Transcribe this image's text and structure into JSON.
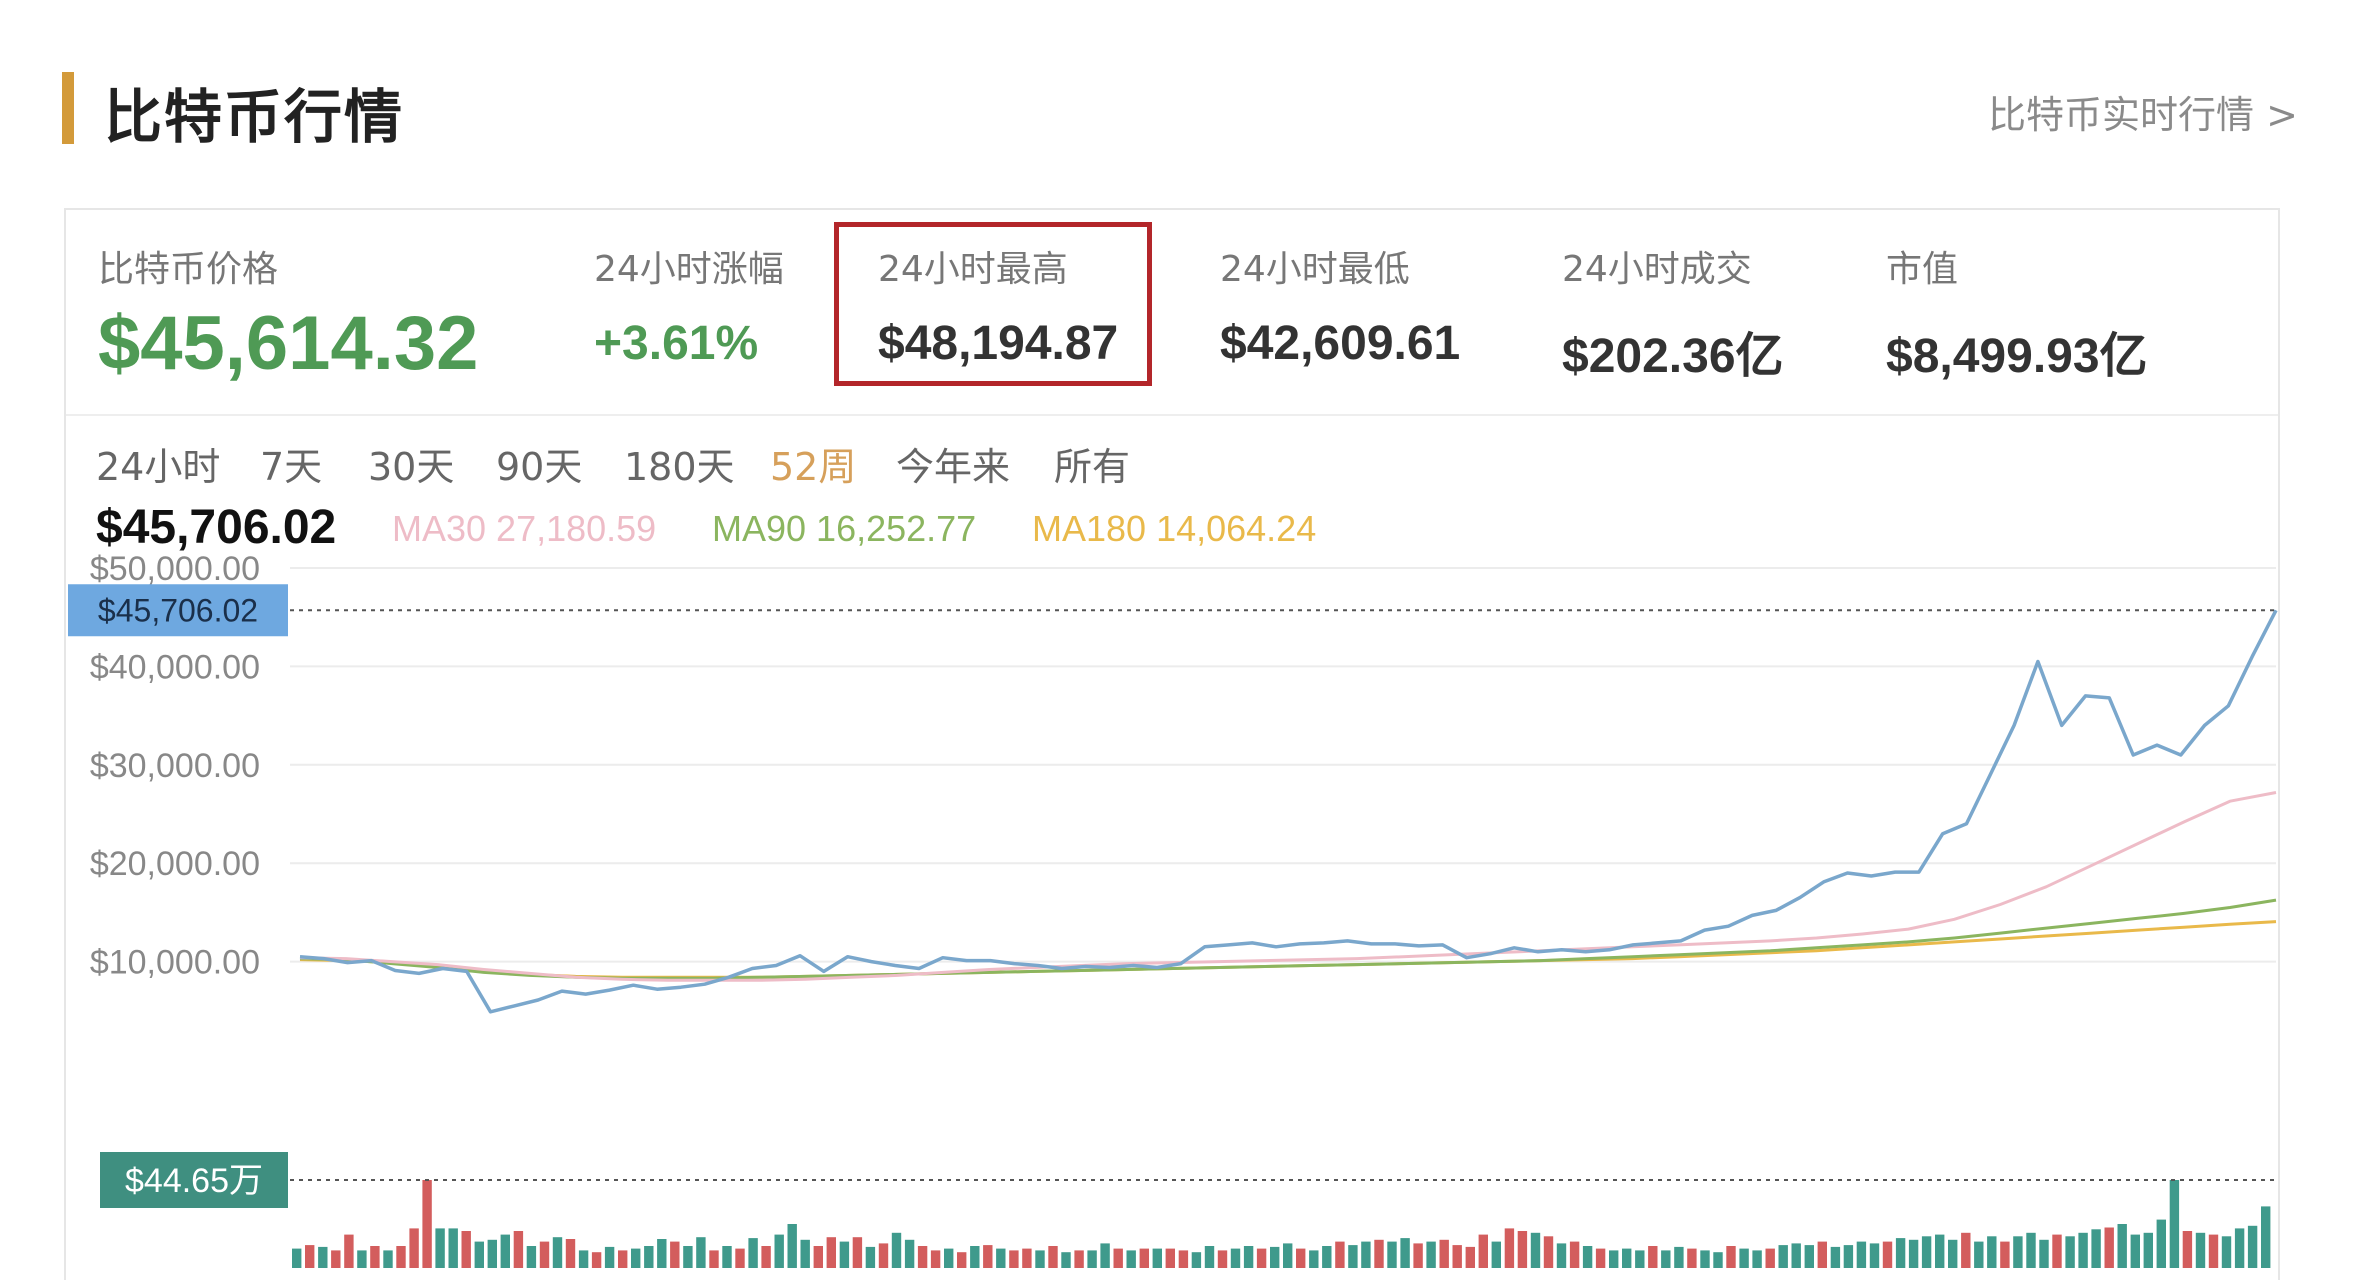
{
  "header": {
    "title": "比特币行情",
    "realtime_link": "比特币实时行情 >"
  },
  "stats": [
    {
      "label": "比特币价格",
      "value": "$45,614.32"
    },
    {
      "label": "24小时涨幅",
      "value": "+3.61%"
    },
    {
      "label": "24小时最高",
      "value": "$48,194.87"
    },
    {
      "label": "24小时最低",
      "value": "$42,609.61"
    },
    {
      "label": "24小时成交",
      "value": "$202.36亿"
    },
    {
      "label": "市值",
      "value": "$8,499.93亿"
    }
  ],
  "ranges": [
    "24小时",
    "7天",
    "30天",
    "90天",
    "180天",
    "52周",
    "今年来",
    "所有"
  ],
  "active_range": "52周",
  "current_price": "$45,706.02",
  "ma": [
    {
      "label": "MA30 27,180.59",
      "color": "#eebcc7"
    },
    {
      "label": "MA90 16,252.77",
      "color": "#8bb55f"
    },
    {
      "label": "MA180 14,064.24",
      "color": "#e9b94a"
    }
  ],
  "colors": {
    "price_up": "#4f9a55",
    "price_line": "#7aa7cc",
    "vol_up": "#3f9a8c",
    "vol_down": "#d35d5d",
    "price_tag": "#6ea8e0",
    "vol_tag": "#3f8f80"
  },
  "chart_data": {
    "type": "line",
    "ylim": [
      0,
      50000
    ],
    "y_ticks": [
      "$50,000.00",
      "$40,000.00",
      "$30,000.00",
      "$20,000.00",
      "$10,000.00"
    ],
    "y_tick_values": [
      50000,
      40000,
      30000,
      20000,
      10000
    ],
    "price_marker": {
      "label": "$45,706.02",
      "value": 45706.02
    },
    "volume_marker": {
      "label": "$44.65万"
    },
    "series": [
      {
        "name": "",
        "values": [
          10500,
          10300,
          9900,
          10100,
          9100,
          8800,
          9300,
          9000,
          4900,
          5500,
          6100,
          7000,
          6700,
          7100,
          7600,
          7200,
          7400,
          7700,
          8400,
          9300,
          9600,
          10600,
          9000,
          10500,
          10000,
          9600,
          9300,
          10400,
          10100,
          10100,
          9800,
          9600,
          9300,
          9500,
          9400,
          9600,
          9400,
          9800,
          11500,
          11700,
          11900,
          11500,
          11800,
          11900,
          12100,
          11800,
          11800,
          11600,
          11700,
          10400,
          10800,
          11400,
          11000,
          11200,
          11000,
          11200,
          11700,
          11900,
          12100,
          13200,
          13600,
          14700,
          15200,
          16500,
          18100,
          19000,
          18700,
          19100,
          19100,
          23000,
          24000,
          29000,
          34000,
          40500,
          34000,
          37000,
          36800,
          31000,
          32000,
          31000,
          34000,
          36000,
          41000,
          45706
        ]
      },
      {
        "name": "MA30",
        "values": [
          10400,
          10300,
          10000,
          9700,
          9200,
          8800,
          8400,
          8200,
          8100,
          8100,
          8100,
          8200,
          8400,
          8600,
          8900,
          9200,
          9400,
          9600,
          9800,
          9900,
          10000,
          10100,
          10200,
          10300,
          10500,
          10700,
          10900,
          11100,
          11300,
          11500,
          11700,
          11900,
          12100,
          12400,
          12800,
          13300,
          14300,
          15800,
          17600,
          19800,
          22000,
          24200,
          26300,
          27181
        ]
      },
      {
        "name": "MA90",
        "values": [
          10300,
          10200,
          9800,
          9400,
          8900,
          8600,
          8400,
          8300,
          8300,
          8300,
          8400,
          8500,
          8600,
          8700,
          8800,
          8900,
          9000,
          9100,
          9200,
          9300,
          9400,
          9500,
          9600,
          9700,
          9800,
          9900,
          10000,
          10100,
          10300,
          10500,
          10700,
          10900,
          11100,
          11400,
          11700,
          12000,
          12400,
          12900,
          13400,
          13900,
          14400,
          14900,
          15500,
          16253
        ]
      },
      {
        "name": "MA180",
        "values": [
          10200,
          10100,
          9900,
          9500,
          9000,
          8700,
          8500,
          8400,
          8400,
          8400,
          8400,
          8500,
          8600,
          8700,
          8800,
          8900,
          9000,
          9100,
          9200,
          9300,
          9400,
          9500,
          9600,
          9700,
          9800,
          9900,
          10000,
          10100,
          10200,
          10300,
          10500,
          10700,
          10900,
          11100,
          11400,
          11700,
          12000,
          12300,
          12600,
          12900,
          13200,
          13500,
          13800,
          14064
        ]
      }
    ],
    "volume": {
      "max_label": "$44.65万",
      "values": [
        0.22,
        0.26,
        0.24,
        0.2,
        0.38,
        0.2,
        0.25,
        0.2,
        0.25,
        0.45,
        1.0,
        0.45,
        0.45,
        0.42,
        0.3,
        0.32,
        0.38,
        0.42,
        0.25,
        0.3,
        0.35,
        0.33,
        0.2,
        0.18,
        0.24,
        0.2,
        0.22,
        0.25,
        0.33,
        0.3,
        0.25,
        0.35,
        0.2,
        0.25,
        0.22,
        0.34,
        0.25,
        0.38,
        0.5,
        0.32,
        0.25,
        0.35,
        0.3,
        0.35,
        0.24,
        0.28,
        0.4,
        0.32,
        0.25,
        0.2,
        0.22,
        0.18,
        0.25,
        0.26,
        0.22,
        0.2,
        0.22,
        0.2,
        0.25,
        0.18,
        0.2,
        0.2,
        0.28,
        0.22,
        0.2,
        0.22,
        0.22,
        0.22,
        0.2,
        0.18,
        0.25,
        0.2,
        0.22,
        0.25,
        0.22,
        0.24,
        0.28,
        0.22,
        0.2,
        0.25,
        0.3,
        0.26,
        0.3,
        0.32,
        0.3,
        0.34,
        0.28,
        0.3,
        0.32,
        0.26,
        0.24,
        0.38,
        0.3,
        0.45,
        0.42,
        0.4,
        0.36,
        0.28,
        0.3,
        0.25,
        0.22,
        0.2,
        0.22,
        0.2,
        0.25,
        0.2,
        0.24,
        0.22,
        0.2,
        0.18,
        0.25,
        0.22,
        0.2,
        0.22,
        0.26,
        0.28,
        0.26,
        0.3,
        0.24,
        0.26,
        0.3,
        0.28,
        0.3,
        0.34,
        0.32,
        0.36,
        0.38,
        0.32,
        0.4,
        0.3,
        0.36,
        0.3,
        0.36,
        0.4,
        0.32,
        0.38,
        0.36,
        0.4,
        0.44,
        0.46,
        0.5,
        0.38,
        0.4,
        0.55,
        1.0,
        0.42,
        0.4,
        0.38,
        0.36,
        0.45,
        0.48,
        0.7
      ],
      "up": [
        1,
        0,
        1,
        0,
        0,
        1,
        0,
        1,
        0,
        0,
        0,
        1,
        1,
        0,
        1,
        1,
        1,
        0,
        1,
        0,
        1,
        0,
        1,
        0,
        1,
        0,
        1,
        1,
        1,
        0,
        1,
        1,
        0,
        1,
        0,
        1,
        0,
        1,
        1,
        1,
        0,
        0,
        1,
        0,
        1,
        0,
        1,
        1,
        0,
        0,
        1,
        0,
        1,
        0,
        1,
        0,
        0,
        1,
        0,
        1,
        0,
        1,
        1,
        0,
        1,
        0,
        1,
        0,
        0,
        1,
        1,
        0,
        1,
        1,
        0,
        1,
        1,
        0,
        1,
        1,
        0,
        1,
        1,
        0,
        1,
        1,
        0,
        1,
        0,
        0,
        0,
        0,
        1,
        0,
        0,
        1,
        0,
        1,
        0,
        1,
        0,
        1,
        1,
        1,
        0,
        1,
        1,
        0,
        1,
        1,
        0,
        1,
        1,
        0,
        1,
        1,
        1,
        0,
        1,
        1,
        1,
        1,
        0,
        1,
        1,
        1,
        1,
        1,
        0,
        1,
        1,
        0,
        1,
        1,
        1,
        0,
        1,
        1,
        1,
        0,
        1,
        1,
        1,
        1,
        1,
        0,
        1,
        0,
        1,
        1,
        1,
        1
      ]
    }
  }
}
